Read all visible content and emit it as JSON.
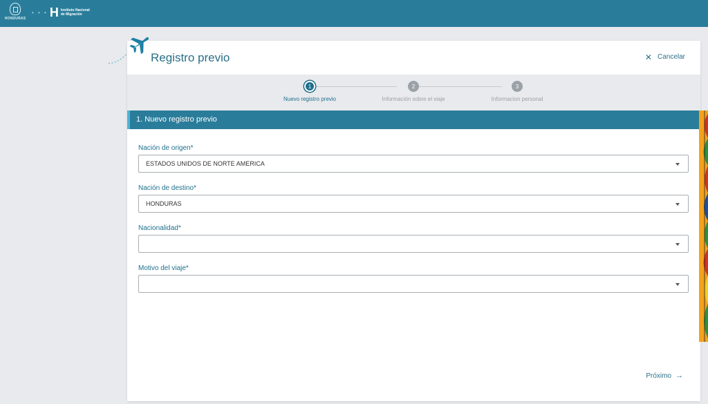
{
  "header": {
    "seal_text": "HONDURAS",
    "institute_line1": "Instituto Nacional",
    "institute_line2": "de Migración",
    "institute_letter": "H"
  },
  "page": {
    "title": "Registro previo",
    "cancel_label": "Cancelar",
    "next_label": "Próximo"
  },
  "stepper": {
    "steps": [
      {
        "number": "1",
        "label": "Nuevo registro previo",
        "active": true
      },
      {
        "number": "2",
        "label": "Información sobre el viaje",
        "active": false
      },
      {
        "number": "3",
        "label": "Informacion personal",
        "active": false
      }
    ]
  },
  "section": {
    "title": "1. Nuevo registro previo"
  },
  "form": {
    "origin_label": "Nación de origen*",
    "origin_value": "ESTADOS UNIDOS DE NORTE AMERICA",
    "destination_label": "Nación de destino*",
    "destination_value": "HONDURAS",
    "nationality_label": "Nacionalidad*",
    "nationality_value": "",
    "reason_label": "Motivo del viaje*",
    "reason_value": ""
  },
  "colors": {
    "brand": "#2a7d9a",
    "accent": "#1e6f8c",
    "background": "#e8eaed"
  }
}
